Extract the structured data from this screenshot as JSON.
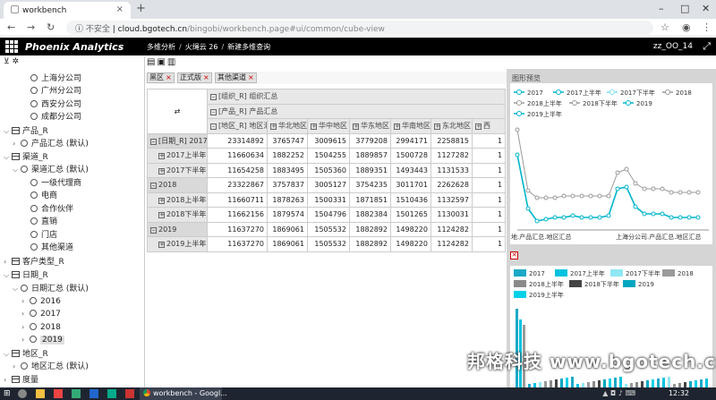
{
  "browser": {
    "tab_title": "workbench",
    "new_tab_glyph": "+",
    "address": {
      "security": "不安全",
      "host": "cloud.bgotech.cn",
      "path": "/bingobi/workbench.page#ui/common/cube-view"
    }
  },
  "app": {
    "brand": "Phoenix Analytics",
    "breadcrumb": [
      "多维分析",
      "火绳云 26",
      "新建多维查询"
    ],
    "user": "zz_OO_14"
  },
  "sidebar": {
    "items": [
      {
        "label": "上海分公司"
      },
      {
        "label": "广州分公司"
      },
      {
        "label": "西安分公司"
      },
      {
        "label": "成都分公司"
      },
      {
        "label": "产品_R"
      },
      {
        "label": "产品汇总 (默认)"
      },
      {
        "label": "渠道_R"
      },
      {
        "label": "渠道汇总 (默认)"
      },
      {
        "label": "一级代理商"
      },
      {
        "label": "电商"
      },
      {
        "label": "合作伙伴"
      },
      {
        "label": "直销"
      },
      {
        "label": "门店"
      },
      {
        "label": "其他渠道"
      },
      {
        "label": "客户类型_R"
      },
      {
        "label": "日期_R"
      },
      {
        "label": "日期汇总 (默认)"
      },
      {
        "label": "2016"
      },
      {
        "label": "2017"
      },
      {
        "label": "2018"
      },
      {
        "label": "2019"
      },
      {
        "label": "地区_R"
      },
      {
        "label": "地区汇总 (默认)"
      },
      {
        "label": "度量"
      }
    ]
  },
  "filters": [
    "黑区",
    "正式版",
    "其他渠道"
  ],
  "pivot": {
    "col_dims": [
      "[组织_R] 组织汇总",
      "[产品_R] 产品汇总"
    ],
    "row_dim": "[地区_R] 地区汇总",
    "columns": [
      "华北地区",
      "华中地区",
      "华东地区",
      "华南地区",
      "东北地区",
      "西"
    ],
    "rows": [
      {
        "label": "[日期_R] 2017",
        "level": 0,
        "values": [
          "23314892",
          "3765747",
          "3009615",
          "3779208",
          "2994171",
          "2258815",
          "1"
        ]
      },
      {
        "label": "2017上半年",
        "level": 1,
        "values": [
          "11660634",
          "1882252",
          "1504255",
          "1889857",
          "1500728",
          "1127282",
          "1"
        ]
      },
      {
        "label": "2017下半年",
        "level": 1,
        "values": [
          "11654258",
          "1883495",
          "1505360",
          "1889351",
          "1493443",
          "1131533",
          "1"
        ]
      },
      {
        "label": "2018",
        "level": 0,
        "values": [
          "23322867",
          "3757837",
          "3005127",
          "3754235",
          "3011701",
          "2262628",
          "1"
        ]
      },
      {
        "label": "2018上半年",
        "level": 1,
        "values": [
          "11660711",
          "1878263",
          "1500331",
          "1871851",
          "1510436",
          "1132597",
          "1"
        ]
      },
      {
        "label": "2018下半年",
        "level": 1,
        "values": [
          "11662156",
          "1879574",
          "1504796",
          "1882384",
          "1501265",
          "1130031",
          "1"
        ]
      },
      {
        "label": "2019",
        "level": 0,
        "values": [
          "11637270",
          "1869061",
          "1505532",
          "1882892",
          "1498220",
          "1124282",
          "1"
        ]
      },
      {
        "label": "2019上半年",
        "level": 1,
        "values": [
          "11637270",
          "1869061",
          "1505532",
          "1882892",
          "1498220",
          "1124282",
          "1"
        ]
      }
    ]
  },
  "chart_panel": {
    "title": "图形预览",
    "line_legend": [
      "2017",
      "2017上半年",
      "2017下半年",
      "2018",
      "2018上半年",
      "2018下半年",
      "2019",
      "2019上半年"
    ],
    "bar_legend": [
      "2017",
      "2017上半年",
      "2017下半年",
      "2018",
      "2018上半年",
      "2018下半年",
      "2019",
      "2019上半年"
    ],
    "x_labels": [
      "地.产品汇总.地区汇总",
      "上海分公司.产品汇总.地区汇总"
    ],
    "colors": {
      "cyan": "#00b5cc",
      "light": "#7fe0ee",
      "grey": "#9a9a9a",
      "dark": "#555555"
    }
  },
  "watermark": "邦格科技 www.bgotech.cn",
  "taskbar": {
    "app": "workbench - Googl...",
    "time": "12:32"
  }
}
